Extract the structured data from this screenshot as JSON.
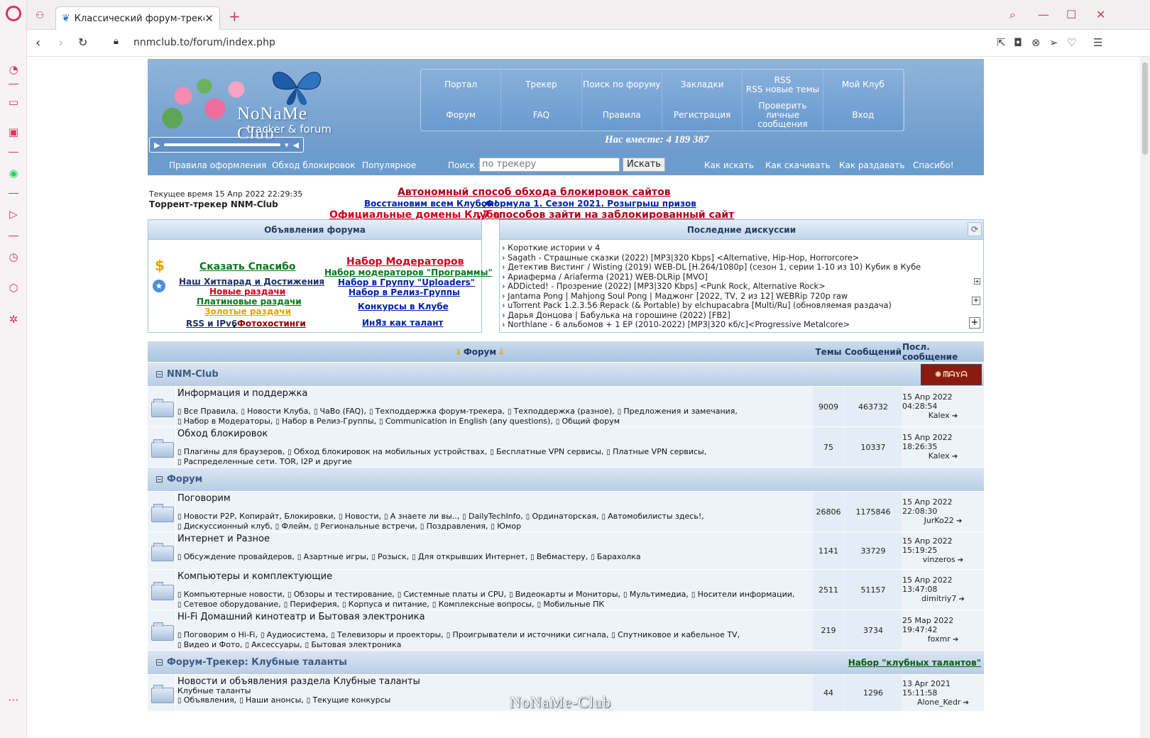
{
  "browser": {
    "tab_title": "Классический форум-трекер",
    "url": "nnmclub.to/forum/index.php"
  },
  "site": {
    "logo_title": "NoNaMe Club",
    "logo_subtitle": "tracker & forum",
    "together": "Нас вместе: 4 189 387",
    "topnav_row1": [
      "Портал",
      "Трекер",
      "Поиск по форуму",
      "Закладки",
      "RSS\nRSS новые темы",
      "Мой Клуб"
    ],
    "topnav_row2": [
      "Форум",
      "FAQ",
      "Правила",
      "Регистрация",
      "Проверить личные сообщения",
      "Вход"
    ],
    "subnav": {
      "rules": "Правила оформления",
      "bypass": "Обход блокировок",
      "popular": "Популярное",
      "search_label": "Поиск :",
      "search_value": "по трекеру",
      "search_button": "Искать",
      "how_search": "Как искать",
      "how_download": "Как скачивать",
      "how_seed": "Как раздавать",
      "thanks": "Спасибо!"
    },
    "current_time": "Текущее время 15 Апр 2022 22:29:35",
    "tracker_name": "Торрент-трекер NNM-Club",
    "announce_line1": "Автономный способ обхода блокировок сайтов",
    "announce_line2a": "Восстановим всем Клубом!",
    "announce_line2b": "Формула 1. Сезон 2021. Розыгрыш призов",
    "announce_line3a": "Официальные домены Клуба",
    "announce_line3b": "7 способов зайти на заблокированный сайт"
  },
  "announce_box": {
    "title": "Объявления форума",
    "say_thanks": "Сказать Спасибо",
    "hitparade": "Наш Хитпарад и Достижения",
    "new_releases": "Новые раздачи",
    "paid_releases": "Платиновые раздачи",
    "gold_releases": "Золотые раздачи",
    "rss_ipv6": "RSS и IPv6",
    "photo_hosting": "Фотохостинги",
    "moderators": "Набор Модераторов",
    "moderators_programs": "Набор модераторов \"Программы\"",
    "uploaders": "Набор в Группу \"Uploaders\"",
    "release_groups": "Набор в Релиз-Группы",
    "contests": "Конкурсы в Клубе",
    "english": "ИнЯз как талант"
  },
  "discuss_box": {
    "title": "Последние дискуссии",
    "items": [
      "› Короткие истории v 4",
      "› Sagath - Страшные сказки (2022) [MP3|320 Kbps] <Alternative, Hip-Hop, Horrorcore>",
      "› Детектив Вистинг / Wisting (2019) WEB-DL [H.264/1080p] (сезон 1, серии 1-10 из 10) Кубик в Кубе",
      "› Ариаферма / Ariaferma (2021) WEB-DLRip [MVO]",
      "› ADDicted! - Прозрение (2022) [MP3|320 Kbps] <Punk Rock, Alternative Rock>",
      "› Jantama Pong | Mahjong Soul Pong | Маджонг [2022, TV, 2 из 12] WEBRip 720p raw",
      "› uTorrent Pack 1.2.3.56 Repack (& Portable) by elchupacabra [Multi/Ru] (обновляемая раздача)",
      "› Дарья Донцова | Бабулька на горошине (2022) [FB2]",
      "› Northlane - 6 альбомов + 1 EP (2010-2022) [MP3|320 кб/с]<Progressive Metalcore>"
    ]
  },
  "forum_table": {
    "header_forum": "Форум",
    "header_topics": "Темы",
    "header_posts": "Сообщений",
    "header_last": "Посл. сообщение",
    "cat1": "NNM-Club",
    "cat2": "Форум",
    "cat3": "Форум-Трекер: Клубные таланты",
    "cat3_link": "Набор \"клубных талантов\"",
    "watermark": "NoNaMe-Club",
    "rows": [
      {
        "title": "Информация и поддержка",
        "line1": [
          "Все Правила,",
          "Новости Клуба,",
          "ЧаВо (FAQ),",
          "Техподдержка форум-трекера,",
          "Техподдержка (разное),",
          "Предложения и замечания,"
        ],
        "line2": [
          "Набор в Модераторы,",
          "Набор в Релиз-Группы,",
          "Communication in English (any questions),",
          "Общий форум"
        ],
        "topics": "9009",
        "posts": "463732",
        "last_date": "15 Апр 2022 04:28:54",
        "last_user": "Kalex"
      },
      {
        "title": "Обход блокировок",
        "line1": [
          "Плагины для браузеров,",
          "Обход блокировок на мобильных устройствах,",
          "Бесплатные VPN сервисы,",
          "Платные VPN сервисы,"
        ],
        "line2": [
          "Распределенные сети. TOR, I2P и другие"
        ],
        "topics": "75",
        "posts": "10337",
        "last_date": "15 Апр 2022 18:26:35",
        "last_user": "Kalex"
      },
      {
        "title": "Поговорим",
        "line1": [
          "Новости P2P, Копирайт, Блокировки,",
          "Новости,",
          "А знаете ли вы..,",
          "DailyTechInfo,",
          "Ординаторская,",
          "Автомобилисты здесь!,"
        ],
        "line2": [
          "Дискуссионный клуб,",
          "Флейм,",
          "Региональные встречи,",
          "Поздравления,",
          "Юмор"
        ],
        "topics": "26806",
        "posts": "1175846",
        "last_date": "15 Апр 2022 22:08:30",
        "last_user": "JurKo22"
      },
      {
        "title": "Интернет и Разное",
        "line1": [
          "Обсуждение провайдеров,",
          "Азартные игры,",
          "Розыск,",
          "Для открывших Интернет,",
          "Вебмастеру,",
          "Барахолка"
        ],
        "line2": [],
        "topics": "1141",
        "posts": "33729",
        "last_date": "15 Апр 2022 15:19:25",
        "last_user": "vinzeros"
      },
      {
        "title": "Компьютеры и комплектующие",
        "line1": [
          "Компьютерные новости,",
          "Обзоры и тестирование,",
          "Системные платы и CPU,",
          "Видеокарты и Мониторы,",
          "Мультимедиа,",
          "Носители информации,"
        ],
        "line2": [
          "Сетевое оборудование,",
          "Периферия,",
          "Корпуса и питание,",
          "Комплексные вопросы,",
          "Мобильные ПК"
        ],
        "topics": "2511",
        "posts": "51157",
        "last_date": "15 Апр 2022 13:47:08",
        "last_user": "dimitriy7"
      },
      {
        "title": "Hi-Fi Домашний кинотеатр и Бытовая электроника",
        "line1": [
          "Поговорим о Hi-Fi,",
          "Аудиосистема,",
          "Телевизоры и проекторы,",
          "Проигрыватели и источники сигнала,",
          "Спутниковое и кабельное TV,"
        ],
        "line2": [
          "Видео и Фото,",
          "Аксессуары,",
          "Бытовая электроника"
        ],
        "topics": "219",
        "posts": "3734",
        "last_date": "25 Мар 2022 19:47:42",
        "last_user": "foxmr"
      },
      {
        "title": "Новости и объявления раздела Клубные таланты",
        "subtitle": "Клубные таланты",
        "line1": [
          "Объявления,",
          "Наши анонсы,",
          "Текущие конкурсы"
        ],
        "line2": [],
        "topics": "44",
        "posts": "1296",
        "last_date": "13 Apr 2021 15:11:58",
        "last_user": "Alone_Kedr"
      }
    ]
  }
}
